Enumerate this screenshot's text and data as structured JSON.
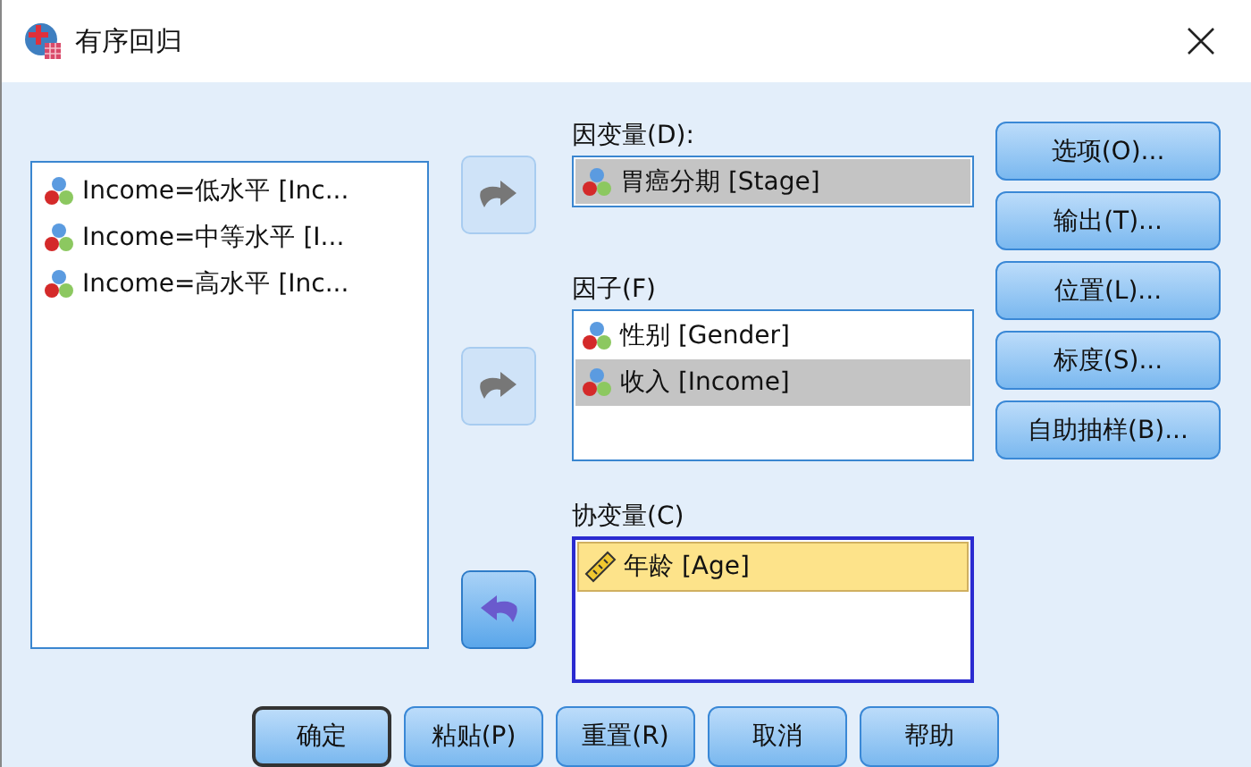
{
  "window": {
    "title": "有序回归"
  },
  "source_list": {
    "items": [
      {
        "label": "Income=低水平 [Inc...",
        "kind": "nominal",
        "selected": false
      },
      {
        "label": "Income=中等水平 [I...",
        "kind": "nominal",
        "selected": false
      },
      {
        "label": "Income=高水平 [Inc...",
        "kind": "nominal",
        "selected": false
      }
    ]
  },
  "targets": [
    {
      "label": "因变量(D):",
      "focused": false,
      "move_button": {
        "kind": "right",
        "enabled": false
      },
      "items": [
        {
          "label": "胃癌分期 [Stage]",
          "kind": "nominal",
          "selected": true
        }
      ]
    },
    {
      "label": "因子(F)",
      "focused": false,
      "move_button": {
        "kind": "right",
        "enabled": false
      },
      "items": [
        {
          "label": "性别 [Gender]",
          "kind": "nominal",
          "selected": false
        },
        {
          "label": "收入 [Income]",
          "kind": "nominal",
          "selected": true
        }
      ]
    },
    {
      "label": "协变量(C)",
      "focused": true,
      "move_button": {
        "kind": "left",
        "enabled": true
      },
      "items": [
        {
          "label": "年龄 [Age]",
          "kind": "scale",
          "selected": true
        }
      ]
    }
  ],
  "side_buttons": [
    "选项(O)...",
    "输出(T)...",
    "位置(L)...",
    "标度(S)...",
    "自助抽样(B)..."
  ],
  "footer_buttons": [
    {
      "label": "确定",
      "default": true
    },
    {
      "label": "粘贴(P)",
      "default": false
    },
    {
      "label": "重置(R)",
      "default": false
    },
    {
      "label": "取消",
      "default": false
    },
    {
      "label": "帮助",
      "default": false
    }
  ]
}
